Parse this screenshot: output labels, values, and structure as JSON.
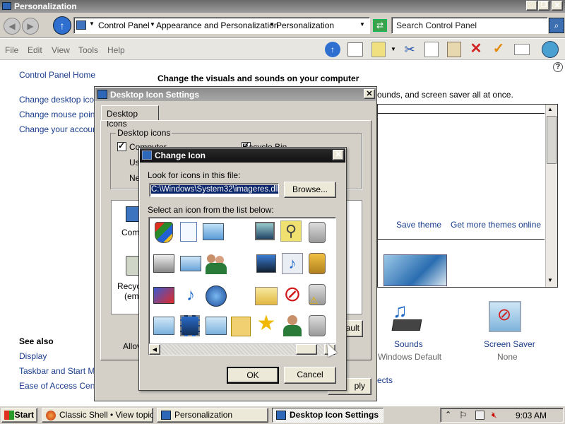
{
  "window": {
    "title": "Personalization"
  },
  "address": {
    "crumbs": [
      "Control Panel",
      "Appearance and Personalization",
      "Personalization"
    ],
    "search_placeholder": "Search Control Panel"
  },
  "menu": [
    "File",
    "Edit",
    "View",
    "Tools",
    "Help"
  ],
  "left": {
    "home": "Control Panel Home",
    "links": [
      "Change desktop icons",
      "Change mouse pointe",
      "Change your account"
    ],
    "see_also_title": "See also",
    "see_also": [
      "Display",
      "Taskbar and Start Men",
      "Ease of Access Cente"
    ]
  },
  "main": {
    "heading": "Change the visuals and sounds on your computer",
    "subtitle_fragment": "ounds, and screen saver all at once.",
    "save_theme": "Save theme",
    "more_themes": "Get more themes online",
    "sounds_label": "Sounds",
    "sounds_value": "Windows Default",
    "screensaver_label": "Screen Saver",
    "screensaver_value": "None",
    "ects_fragment": "ects"
  },
  "dis": {
    "title": "Desktop Icon Settings",
    "tab": "Desktop Icons",
    "group": "Desktop icons",
    "check_computer": "Computer",
    "check_recycle": "Recycle Bin",
    "check_us": "Us",
    "check_ne": "Ne",
    "preview_comp": "Comp",
    "preview_recy": "Recyc",
    "preview_emp": "(emp",
    "allow": "Allov",
    "default_fragment": "ault",
    "apply_fragment": "ply"
  },
  "change_icon": {
    "title": "Change Icon",
    "look_label": "Look for icons in this file:",
    "file_value": "C:\\Windows\\System32\\imageres.dll",
    "browse": "Browse...",
    "select_label": "Select an icon from the list below:",
    "ok": "OK",
    "cancel": "Cancel"
  },
  "taskbar": {
    "start": "Start",
    "items": [
      "Classic Shell • View topic ...",
      "Personalization",
      "Desktop Icon Settings"
    ],
    "time": "9:03 AM"
  },
  "colors": {
    "titlebar": "#1a1a1a",
    "link": "#1a3d8c",
    "selection": "#0a246a",
    "chrome": "#d4d0c8"
  }
}
